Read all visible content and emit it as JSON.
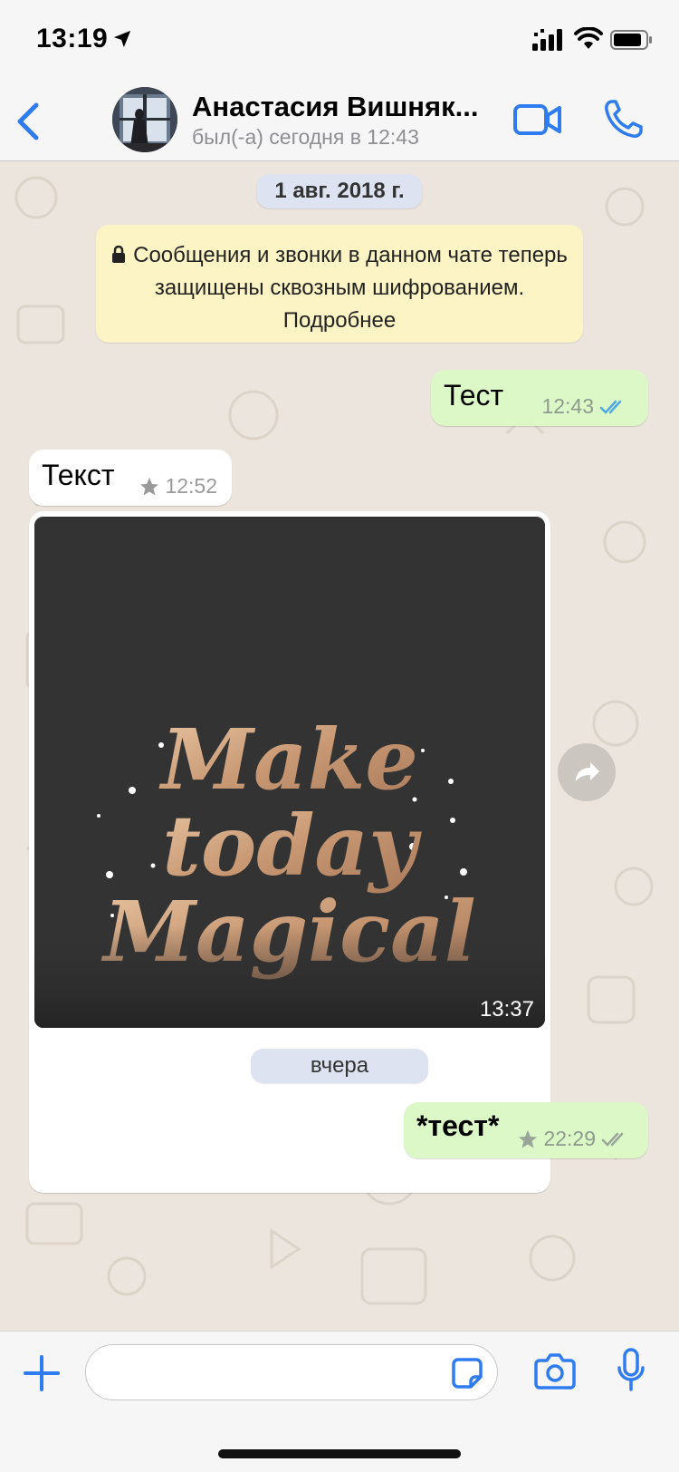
{
  "status_bar": {
    "time": "13:19",
    "icons": [
      "location-arrow-icon",
      "cellular-signal-icon",
      "wifi-icon",
      "battery-icon"
    ]
  },
  "header": {
    "contact_name": "Анастасия Вишняк...",
    "contact_status": "был(-а) сегодня в 12:43",
    "icons": [
      "back-chevron-icon",
      "video-call-icon",
      "phone-call-icon"
    ]
  },
  "chat": {
    "date_chip_1": "1 авг. 2018 г.",
    "system_notice": "Сообщения и звонки в данном чате теперь защищены сквозным шифрованием. Подробнее",
    "messages": [
      {
        "direction": "outgoing",
        "text": "Тест",
        "time": "12:43",
        "status": "read"
      },
      {
        "direction": "incoming",
        "text": "Текст",
        "time": "12:52",
        "starred": true
      },
      {
        "direction": "incoming",
        "type": "image",
        "image_text": "Make today Magical",
        "time": "13:37"
      },
      {
        "direction": "outgoing",
        "text": "*тест*",
        "time": "22:29",
        "starred": true,
        "status": "delivered"
      }
    ],
    "date_chip_2": "вчера"
  },
  "input_bar": {
    "placeholder": "",
    "icons": [
      "plus-icon",
      "sticker-icon",
      "camera-icon",
      "microphone-icon"
    ]
  },
  "colors": {
    "accent": "#2f7bf0",
    "outgoing_bubble": "#dcf8c6",
    "incoming_bubble": "#ffffff",
    "notice_bg": "#fdf4c5",
    "chat_bg": "#ece5dd",
    "read_ticks": "#4fa9e8"
  }
}
